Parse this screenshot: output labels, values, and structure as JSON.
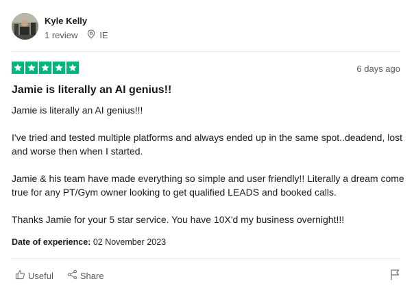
{
  "reviewer": {
    "name": "Kyle Kelly",
    "review_count": "1 review",
    "country": "IE"
  },
  "review": {
    "rating": 5,
    "date_relative": "6 days ago",
    "title": "Jamie is literally an AI genius!!",
    "paragraphs": [
      "Jamie is literally an AI genius!!!",
      "I've tried and tested multiple platforms and always ended up in the same spot..deadend, lost and worse then when I started.",
      "Jamie & his team have made everything so simple and user friendly!! Literally a dream come true for any PT/Gym owner looking to get qualified LEADS and booked calls.",
      "Thanks Jamie for your 5 star service. You have 10X'd my business overnight!!!"
    ],
    "experience_label": "Date of experience:",
    "experience_date": "02 November 2023"
  },
  "actions": {
    "useful_label": "Useful",
    "share_label": "Share"
  },
  "icons": {
    "location": "location-pin-icon",
    "star": "star-icon",
    "useful": "thumbs-up-icon",
    "share": "share-icon",
    "flag": "flag-icon"
  },
  "colors": {
    "star_green": "#00b67a",
    "text_primary": "#191919",
    "text_secondary": "#5a5a5a",
    "divider": "#e5e5dd"
  }
}
